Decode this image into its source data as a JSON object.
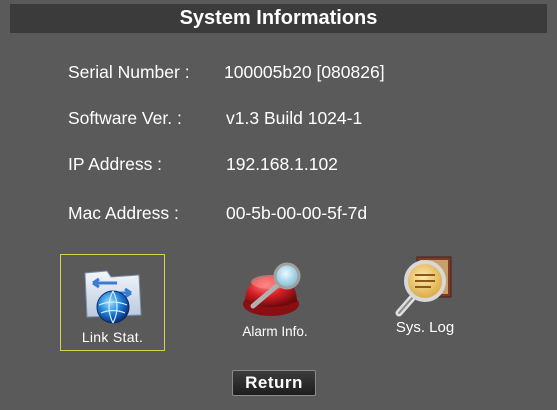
{
  "window": {
    "title": "System Informations"
  },
  "info": {
    "serial": {
      "label": "Serial Number :",
      "value": "100005b20 [080826]"
    },
    "software": {
      "label": "Software Ver. :",
      "value": "v1.3 Build 1024-1"
    },
    "ip": {
      "label": "IP Address :",
      "value": "192.168.1.102"
    },
    "mac": {
      "label": "Mac Address :",
      "value": "00-5b-00-00-5f-7d"
    }
  },
  "shortcuts": [
    {
      "label": "Link Stat.",
      "icon": "network-link-icon",
      "selected": true
    },
    {
      "label": "Alarm Info.",
      "icon": "alarm-siren-icon",
      "selected": false
    },
    {
      "label": "Sys. Log",
      "icon": "magnifier-log-icon",
      "selected": false
    }
  ],
  "actions": {
    "return_label": "Return"
  },
  "colors": {
    "panel": "#5a5a5a",
    "title_bar": "#3b3b3b",
    "selection_border": "#d8d24a",
    "text": "#ffffff"
  }
}
